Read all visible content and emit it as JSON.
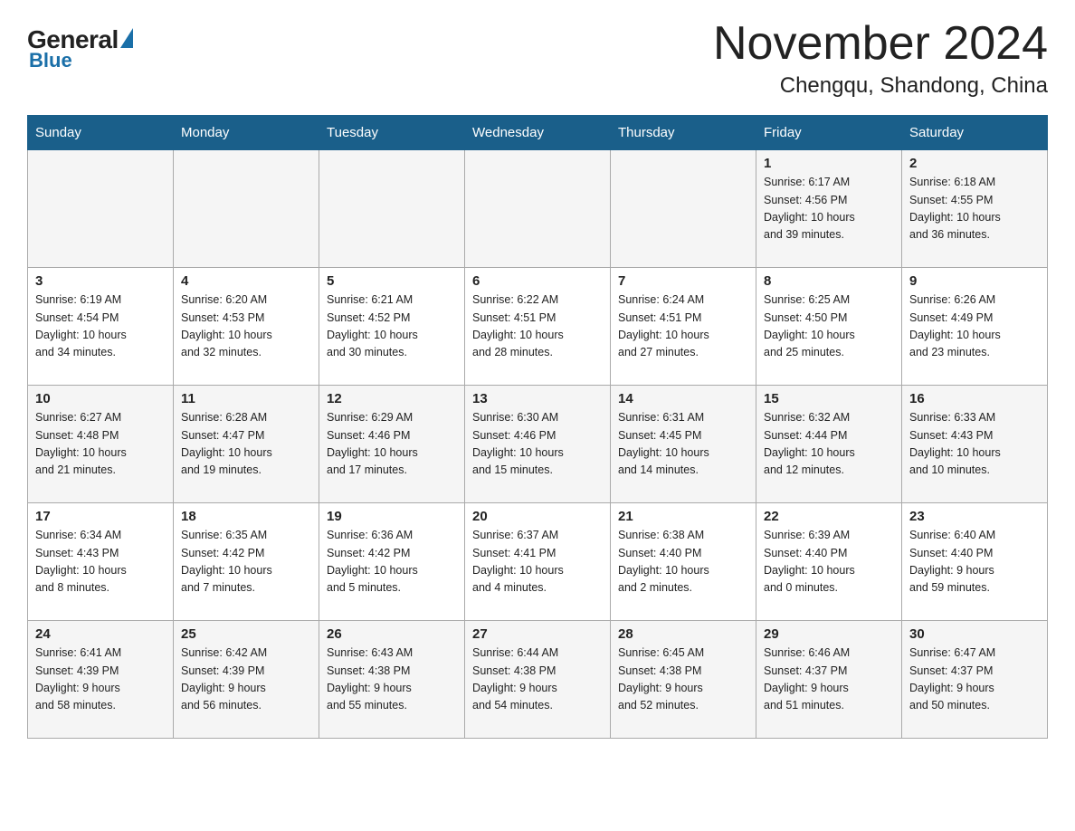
{
  "logo": {
    "general": "General",
    "blue": "Blue"
  },
  "title": "November 2024",
  "subtitle": "Chengqu, Shandong, China",
  "weekdays": [
    "Sunday",
    "Monday",
    "Tuesday",
    "Wednesday",
    "Thursday",
    "Friday",
    "Saturday"
  ],
  "rows": [
    [
      {
        "day": "",
        "info": ""
      },
      {
        "day": "",
        "info": ""
      },
      {
        "day": "",
        "info": ""
      },
      {
        "day": "",
        "info": ""
      },
      {
        "day": "",
        "info": ""
      },
      {
        "day": "1",
        "info": "Sunrise: 6:17 AM\nSunset: 4:56 PM\nDaylight: 10 hours\nand 39 minutes."
      },
      {
        "day": "2",
        "info": "Sunrise: 6:18 AM\nSunset: 4:55 PM\nDaylight: 10 hours\nand 36 minutes."
      }
    ],
    [
      {
        "day": "3",
        "info": "Sunrise: 6:19 AM\nSunset: 4:54 PM\nDaylight: 10 hours\nand 34 minutes."
      },
      {
        "day": "4",
        "info": "Sunrise: 6:20 AM\nSunset: 4:53 PM\nDaylight: 10 hours\nand 32 minutes."
      },
      {
        "day": "5",
        "info": "Sunrise: 6:21 AM\nSunset: 4:52 PM\nDaylight: 10 hours\nand 30 minutes."
      },
      {
        "day": "6",
        "info": "Sunrise: 6:22 AM\nSunset: 4:51 PM\nDaylight: 10 hours\nand 28 minutes."
      },
      {
        "day": "7",
        "info": "Sunrise: 6:24 AM\nSunset: 4:51 PM\nDaylight: 10 hours\nand 27 minutes."
      },
      {
        "day": "8",
        "info": "Sunrise: 6:25 AM\nSunset: 4:50 PM\nDaylight: 10 hours\nand 25 minutes."
      },
      {
        "day": "9",
        "info": "Sunrise: 6:26 AM\nSunset: 4:49 PM\nDaylight: 10 hours\nand 23 minutes."
      }
    ],
    [
      {
        "day": "10",
        "info": "Sunrise: 6:27 AM\nSunset: 4:48 PM\nDaylight: 10 hours\nand 21 minutes."
      },
      {
        "day": "11",
        "info": "Sunrise: 6:28 AM\nSunset: 4:47 PM\nDaylight: 10 hours\nand 19 minutes."
      },
      {
        "day": "12",
        "info": "Sunrise: 6:29 AM\nSunset: 4:46 PM\nDaylight: 10 hours\nand 17 minutes."
      },
      {
        "day": "13",
        "info": "Sunrise: 6:30 AM\nSunset: 4:46 PM\nDaylight: 10 hours\nand 15 minutes."
      },
      {
        "day": "14",
        "info": "Sunrise: 6:31 AM\nSunset: 4:45 PM\nDaylight: 10 hours\nand 14 minutes."
      },
      {
        "day": "15",
        "info": "Sunrise: 6:32 AM\nSunset: 4:44 PM\nDaylight: 10 hours\nand 12 minutes."
      },
      {
        "day": "16",
        "info": "Sunrise: 6:33 AM\nSunset: 4:43 PM\nDaylight: 10 hours\nand 10 minutes."
      }
    ],
    [
      {
        "day": "17",
        "info": "Sunrise: 6:34 AM\nSunset: 4:43 PM\nDaylight: 10 hours\nand 8 minutes."
      },
      {
        "day": "18",
        "info": "Sunrise: 6:35 AM\nSunset: 4:42 PM\nDaylight: 10 hours\nand 7 minutes."
      },
      {
        "day": "19",
        "info": "Sunrise: 6:36 AM\nSunset: 4:42 PM\nDaylight: 10 hours\nand 5 minutes."
      },
      {
        "day": "20",
        "info": "Sunrise: 6:37 AM\nSunset: 4:41 PM\nDaylight: 10 hours\nand 4 minutes."
      },
      {
        "day": "21",
        "info": "Sunrise: 6:38 AM\nSunset: 4:40 PM\nDaylight: 10 hours\nand 2 minutes."
      },
      {
        "day": "22",
        "info": "Sunrise: 6:39 AM\nSunset: 4:40 PM\nDaylight: 10 hours\nand 0 minutes."
      },
      {
        "day": "23",
        "info": "Sunrise: 6:40 AM\nSunset: 4:40 PM\nDaylight: 9 hours\nand 59 minutes."
      }
    ],
    [
      {
        "day": "24",
        "info": "Sunrise: 6:41 AM\nSunset: 4:39 PM\nDaylight: 9 hours\nand 58 minutes."
      },
      {
        "day": "25",
        "info": "Sunrise: 6:42 AM\nSunset: 4:39 PM\nDaylight: 9 hours\nand 56 minutes."
      },
      {
        "day": "26",
        "info": "Sunrise: 6:43 AM\nSunset: 4:38 PM\nDaylight: 9 hours\nand 55 minutes."
      },
      {
        "day": "27",
        "info": "Sunrise: 6:44 AM\nSunset: 4:38 PM\nDaylight: 9 hours\nand 54 minutes."
      },
      {
        "day": "28",
        "info": "Sunrise: 6:45 AM\nSunset: 4:38 PM\nDaylight: 9 hours\nand 52 minutes."
      },
      {
        "day": "29",
        "info": "Sunrise: 6:46 AM\nSunset: 4:37 PM\nDaylight: 9 hours\nand 51 minutes."
      },
      {
        "day": "30",
        "info": "Sunrise: 6:47 AM\nSunset: 4:37 PM\nDaylight: 9 hours\nand 50 minutes."
      }
    ]
  ]
}
